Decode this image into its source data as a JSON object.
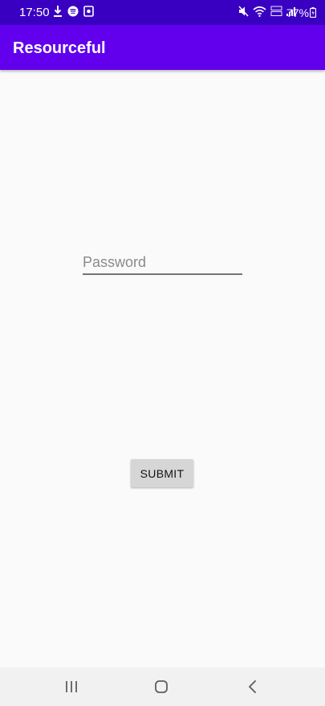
{
  "status_bar": {
    "time": "17:50",
    "battery": "77%",
    "background": "#3a00c2",
    "icons": [
      "download-icon",
      "spotify-icon",
      "gallery-icon",
      "mute-icon",
      "wifi-icon",
      "volte-icon",
      "signal-icon",
      "battery-icon"
    ]
  },
  "app_bar": {
    "title": "Resourceful",
    "background": "#6200ee"
  },
  "form": {
    "password_placeholder": "Password",
    "password_value": "",
    "submit_label": "SUBMIT"
  },
  "nav_bar": {
    "icons": [
      "recents-icon",
      "home-icon",
      "back-icon"
    ]
  }
}
